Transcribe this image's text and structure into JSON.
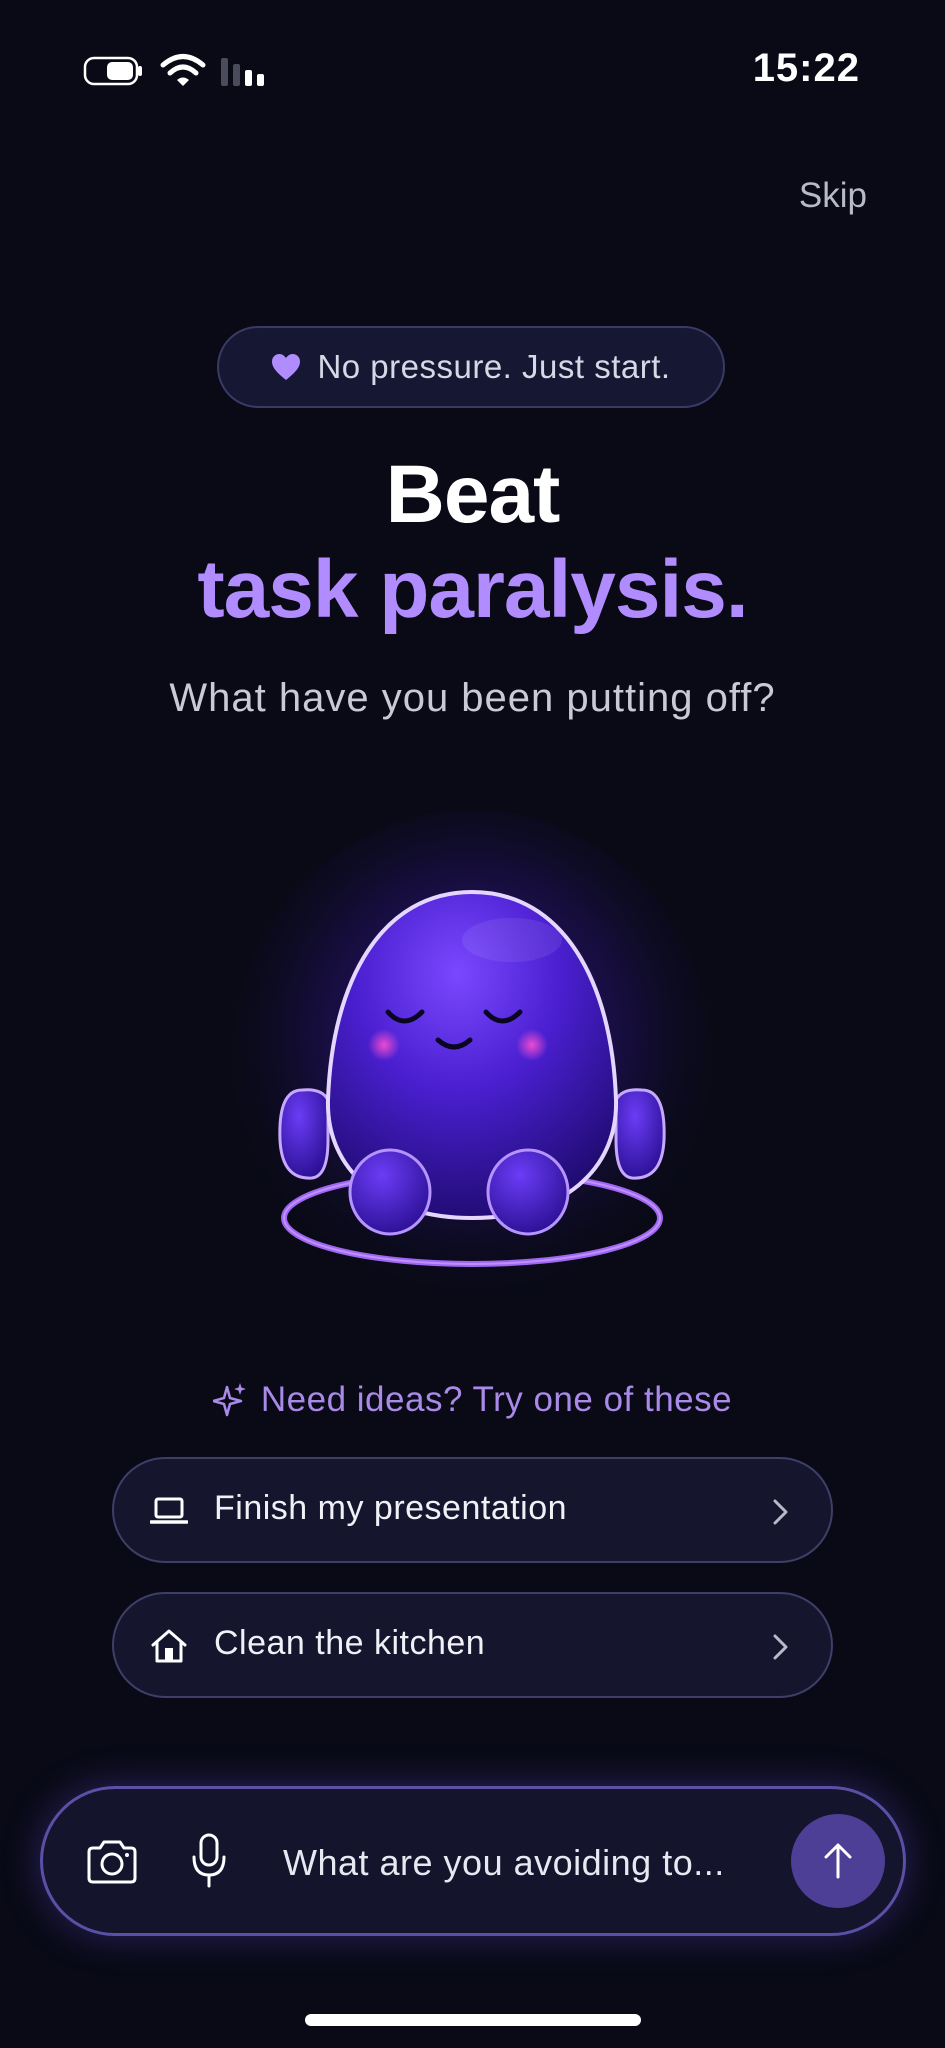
{
  "status_bar": {
    "time": "15:22",
    "battery_icon": "battery-icon",
    "wifi_icon": "wifi-icon",
    "signal_icon": "cellular-signal-icon"
  },
  "header": {
    "skip_label": "Skip"
  },
  "badge": {
    "icon": "heart-icon",
    "text": "No pressure. Just start."
  },
  "hero": {
    "title_line1": "Beat",
    "title_line2": "task paralysis.",
    "subtitle": "What have you been putting off?"
  },
  "mascot": {
    "icon": "sleepy-purple-mascot"
  },
  "ideas": {
    "icon": "sparkle-icon",
    "heading": "Need ideas? Try one of these",
    "suggestions": [
      {
        "label": "Finish my presentation",
        "icon": "laptop-icon"
      },
      {
        "label": "Clean the kitchen",
        "icon": "house-icon"
      }
    ]
  },
  "composer": {
    "camera_icon": "camera-icon",
    "mic_icon": "microphone-icon",
    "placeholder": "What are you avoiding to...",
    "value": "",
    "send_icon": "arrow-up-icon"
  },
  "colors": {
    "background": "#090a16",
    "accent": "#b18cff",
    "send_button": "#4d3f96",
    "border": "#3e3e68"
  }
}
